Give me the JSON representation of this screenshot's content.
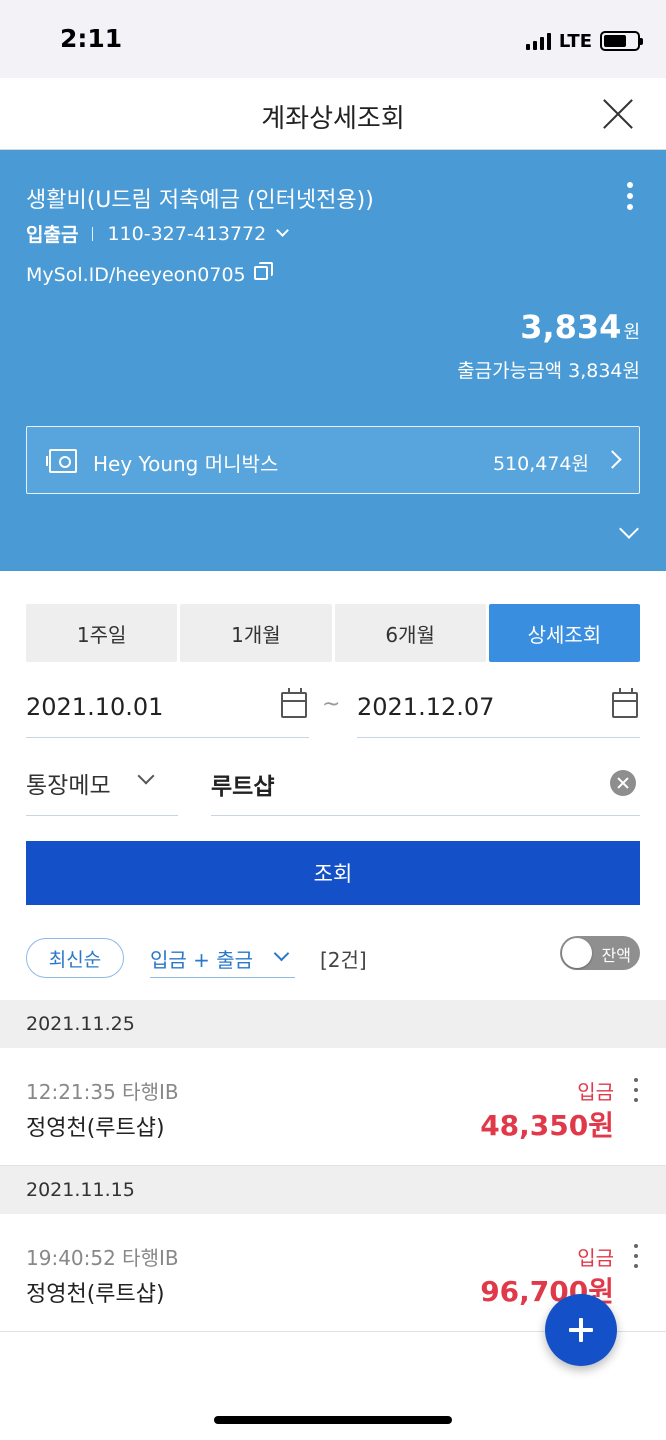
{
  "status_bar": {
    "time": "2:11",
    "network": "LTE"
  },
  "nav": {
    "title": "계좌상세조회"
  },
  "account": {
    "name": "생활비(U드림 저축예금 (인터넷전용))",
    "type": "입출금",
    "number": "110-327-413772",
    "sol_id": "MySol.ID/heeyeon0705",
    "balance": "3,834",
    "balance_unit": "원",
    "withdrawable": "출금가능금액 3,834원"
  },
  "moneybox": {
    "label": "Hey Young 머니박스",
    "amount": "510,474원"
  },
  "period_tabs": [
    {
      "label": "1주일",
      "active": false
    },
    {
      "label": "1개월",
      "active": false
    },
    {
      "label": "6개월",
      "active": false
    },
    {
      "label": "상세조회",
      "active": true
    }
  ],
  "date_range": {
    "from": "2021.10.01",
    "separator": "~",
    "to": "2021.12.07"
  },
  "memo": {
    "filter_label": "통장메모",
    "value": "루트샵"
  },
  "search_button": "조회",
  "filters": {
    "sort": "최신순",
    "type": "입금 + 출금",
    "count": "[2건]",
    "balance_toggle": "잔액"
  },
  "transactions": [
    {
      "date": "2021.11.25",
      "time": "12:21:35 타행IB",
      "desc": "정영천(루트샵)",
      "type": "입금",
      "amount": "48,350원"
    },
    {
      "date": "2021.11.15",
      "time": "19:40:52 타행IB",
      "desc": "정영천(루트샵)",
      "type": "입금",
      "amount": "96,700원"
    }
  ],
  "colors": {
    "primary": "#1450c8",
    "panel": "#4a9ad6",
    "deposit": "#e03a4a",
    "tab_active": "#3a8ee0"
  }
}
